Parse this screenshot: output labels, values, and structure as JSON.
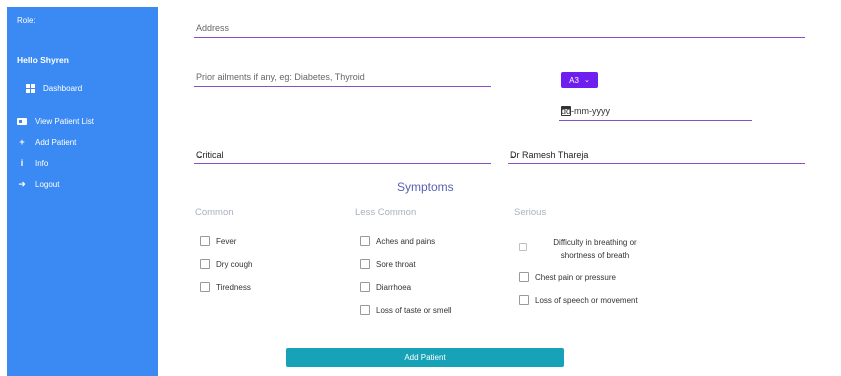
{
  "sidebar": {
    "role_label": "Role:",
    "greeting": "Hello Shyren",
    "items": [
      {
        "label": "Dashboard",
        "icon": "dashboard-icon"
      },
      {
        "label": "View Patient List",
        "icon": "id-card-icon"
      },
      {
        "label": "Add Patient",
        "icon": "plus-icon"
      },
      {
        "label": "Info",
        "icon": "info-icon"
      },
      {
        "label": "Logout",
        "icon": "logout-icon"
      }
    ],
    "color": "#3b8af3"
  },
  "form": {
    "address_placeholder": "Address",
    "ailments_placeholder": "Prior ailments if any, eg: Diabetes, Thyroid",
    "ward_value": "A3",
    "date_placeholder": "dd-mm-yyyy",
    "severity_value": "Critical",
    "doctor_value": "Dr Ramesh Thareja",
    "accent": "#6f1ef0"
  },
  "symptoms": {
    "title": "Symptoms",
    "common": {
      "heading": "Common",
      "items": [
        "Fever",
        "Dry cough",
        "Tiredness"
      ]
    },
    "less_common": {
      "heading": "Less Common",
      "items": [
        "Aches and pains",
        "Sore throat",
        "Diarrhoea",
        "Loss of taste or smell"
      ]
    },
    "serious": {
      "heading": "Serious",
      "items": [
        "Difficulty in breathing or",
        "shortness of breath",
        "Chest pain or pressure",
        "Loss of speech or movement"
      ]
    }
  },
  "submit_label": "Add Patient"
}
